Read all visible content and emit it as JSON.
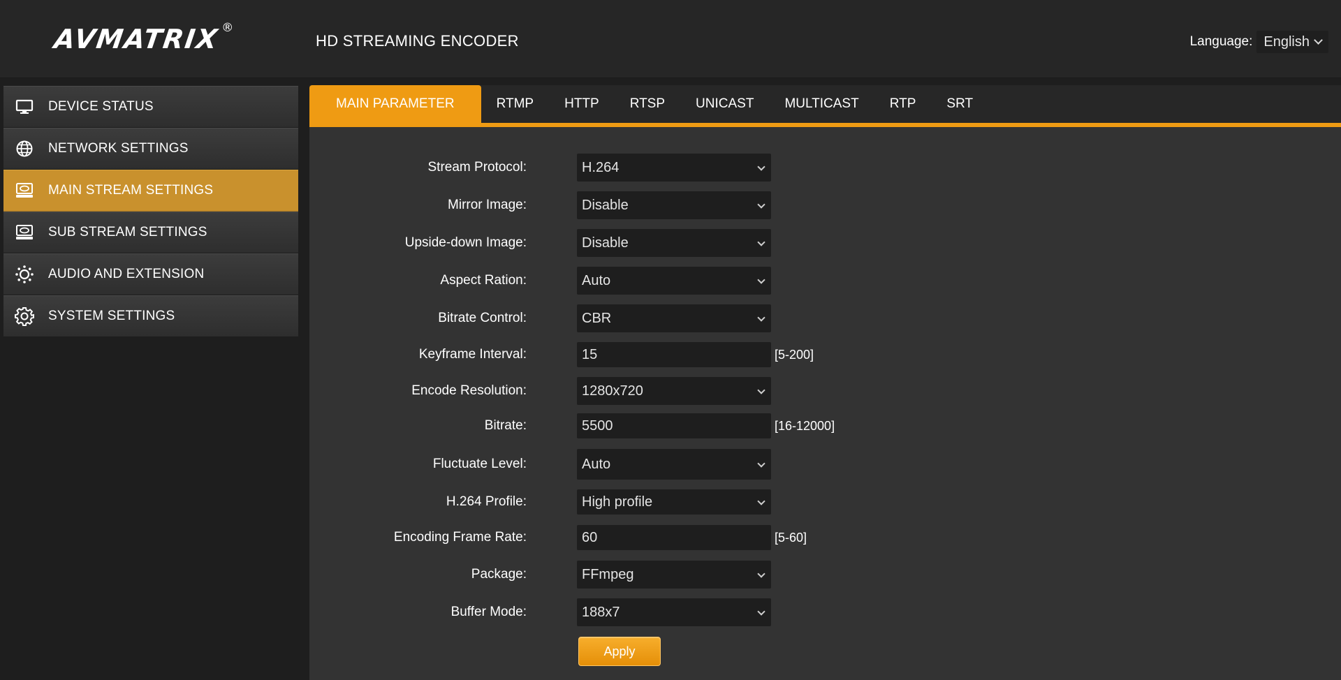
{
  "header": {
    "logo": "AVMATRIX",
    "logo_reg": "®",
    "product_title": "HD STREAMING ENCODER",
    "language_label": "Language:",
    "language_value": "English"
  },
  "sidebar": {
    "items": [
      {
        "label": "DEVICE STATUS",
        "icon": "monitor-icon",
        "active": false
      },
      {
        "label": "NETWORK SETTINGS",
        "icon": "globe-icon",
        "active": false
      },
      {
        "label": "MAIN STREAM SETTINGS",
        "icon": "stream-icon",
        "active": true
      },
      {
        "label": "SUB STREAM SETTINGS",
        "icon": "stream-icon",
        "active": false
      },
      {
        "label": "AUDIO AND EXTENSION",
        "icon": "sun-gear-icon",
        "active": false
      },
      {
        "label": "SYSTEM SETTINGS",
        "icon": "gear-icon",
        "active": false
      }
    ]
  },
  "tabs": [
    {
      "label": "MAIN PARAMETER",
      "active": true
    },
    {
      "label": "RTMP",
      "active": false
    },
    {
      "label": "HTTP",
      "active": false
    },
    {
      "label": "RTSP",
      "active": false
    },
    {
      "label": "UNICAST",
      "active": false
    },
    {
      "label": "MULTICAST",
      "active": false
    },
    {
      "label": "RTP",
      "active": false
    },
    {
      "label": "SRT",
      "active": false
    }
  ],
  "form": {
    "stream_protocol": {
      "label": "Stream Protocol:",
      "value": "H.264"
    },
    "mirror_image": {
      "label": "Mirror Image:",
      "value": "Disable"
    },
    "upside_down_image": {
      "label": "Upside-down Image:",
      "value": "Disable"
    },
    "aspect_ration": {
      "label": "Aspect Ration:",
      "value": "Auto"
    },
    "bitrate_control": {
      "label": "Bitrate Control:",
      "value": "CBR"
    },
    "keyframe_interval": {
      "label": "Keyframe Interval:",
      "value": "15",
      "range": "[5-200]"
    },
    "encode_resolution": {
      "label": "Encode Resolution:",
      "value": "1280x720"
    },
    "bitrate": {
      "label": "Bitrate:",
      "value": "5500",
      "range": "[16-12000]"
    },
    "fluctuate_level": {
      "label": "Fluctuate Level:",
      "value": "Auto"
    },
    "h264_profile": {
      "label": "H.264 Profile:",
      "value": "High profile"
    },
    "encoding_frame_rate": {
      "label": "Encoding Frame Rate:",
      "value": "60",
      "range": "[5-60]"
    },
    "package": {
      "label": "Package:",
      "value": "FFmpeg"
    },
    "buffer_mode": {
      "label": "Buffer Mode:",
      "value": "188x7"
    },
    "apply_label": "Apply"
  },
  "colors": {
    "accent": "#ef9b13",
    "sidebar_active": "#c9912d",
    "panel_bg": "#333333",
    "page_bg": "#1e1e1e"
  }
}
